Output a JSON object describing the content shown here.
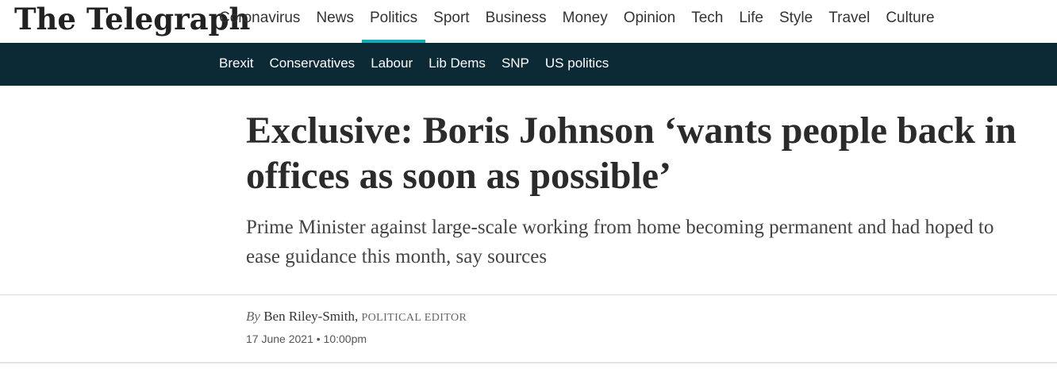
{
  "brand": {
    "logo_text": "The Telegraph"
  },
  "main_nav": [
    {
      "label": "Coronavirus"
    },
    {
      "label": "News"
    },
    {
      "label": "Politics",
      "active": true
    },
    {
      "label": "Sport"
    },
    {
      "label": "Business"
    },
    {
      "label": "Money"
    },
    {
      "label": "Opinion"
    },
    {
      "label": "Tech"
    },
    {
      "label": "Life"
    },
    {
      "label": "Style"
    },
    {
      "label": "Travel"
    },
    {
      "label": "Culture"
    }
  ],
  "sub_nav": [
    {
      "label": "Brexit"
    },
    {
      "label": "Conservatives"
    },
    {
      "label": "Labour"
    },
    {
      "label": "Lib Dems"
    },
    {
      "label": "SNP"
    },
    {
      "label": "US politics"
    }
  ],
  "article": {
    "headline": "Exclusive: Boris Johnson ‘wants people back in offices as soon as possible’",
    "standfirst": "Prime Minister against large-scale working from home becoming permanent and had hoped to ease guidance this month, say sources",
    "byline_prefix": "By",
    "author": "Ben Riley-Smith,",
    "author_role": "POLITICAL EDITOR",
    "date": "17 June 2021 • 10:00pm"
  },
  "colors": {
    "accent": "#13aab4",
    "subnav_bg": "#0b2a35",
    "text": "#2b2b2b"
  }
}
